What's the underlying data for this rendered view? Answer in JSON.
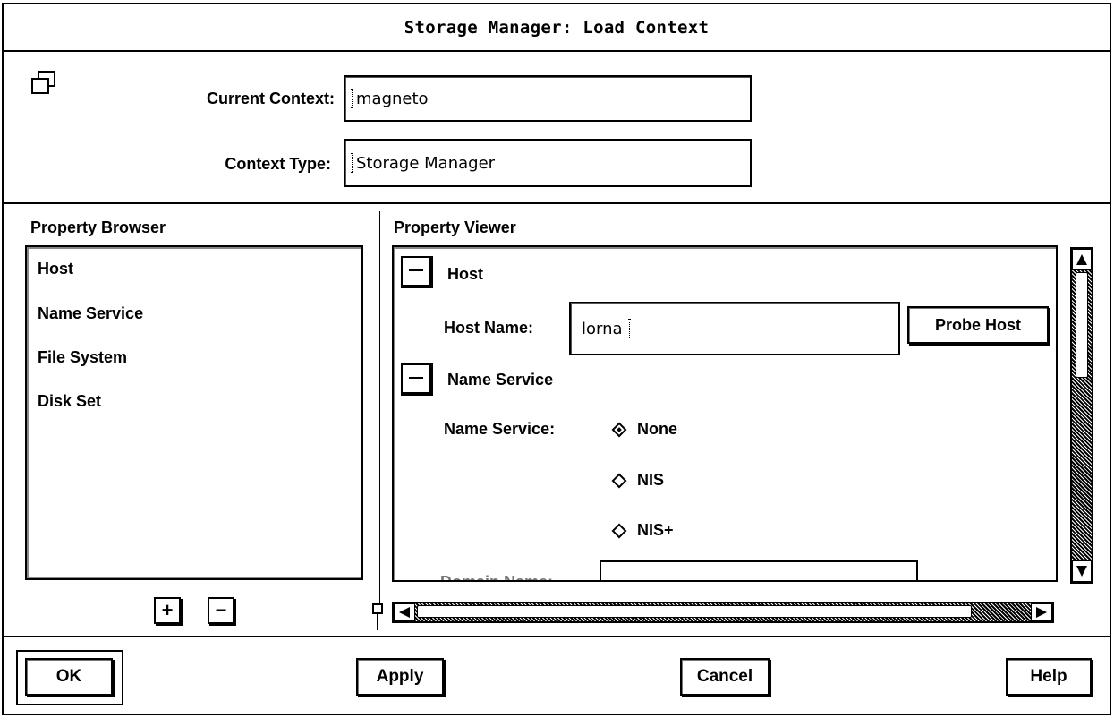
{
  "window": {
    "title": "Storage Manager: Load Context"
  },
  "header": {
    "icon": "window-restore-icon",
    "current_context_label": "Current Context:",
    "current_context_value": "magneto",
    "context_type_label": "Context Type:",
    "context_type_value": "Storage Manager"
  },
  "browser": {
    "title": "Property Browser",
    "items": [
      {
        "label": "Host"
      },
      {
        "label": "Name Service"
      },
      {
        "label": "File System"
      },
      {
        "label": "Disk Set"
      }
    ],
    "add_symbol": "+",
    "remove_symbol": "−"
  },
  "viewer": {
    "title": "Property Viewer",
    "host_section": "Host",
    "host_name_label": "Host Name:",
    "host_name_value": "lorna",
    "probe_host_button": "Probe Host",
    "name_service_section": "Name Service",
    "name_service_label": "Name Service:",
    "name_service_options": [
      {
        "label": "None",
        "selected": true
      },
      {
        "label": "NIS",
        "selected": false
      },
      {
        "label": "NIS+",
        "selected": false
      }
    ],
    "domain_name_label": "Domain Name:"
  },
  "footer": {
    "ok": "OK",
    "apply": "Apply",
    "cancel": "Cancel",
    "help": "Help"
  }
}
